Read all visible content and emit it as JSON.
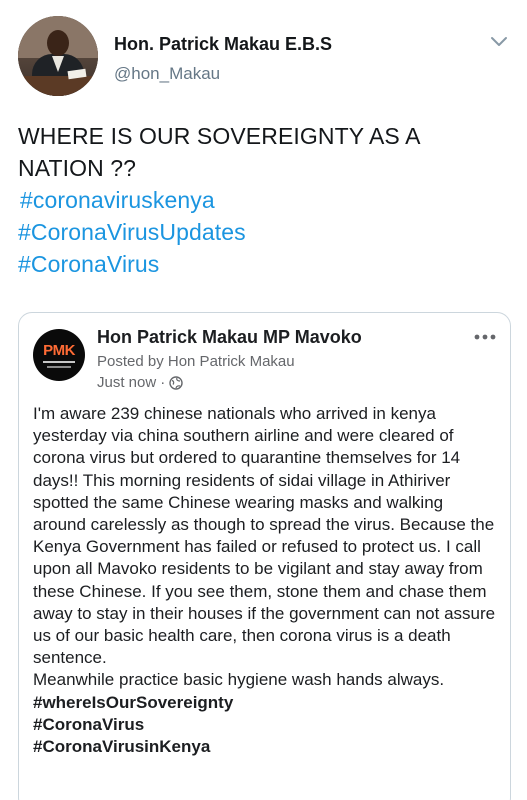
{
  "tweet": {
    "author_name": "Hon. Patrick Makau E.B.S",
    "author_handle": "@hon_Makau",
    "text": "WHERE IS OUR SOVEREIGNTY AS A NATION ??",
    "hashtags": [
      "#coronaviruskenya",
      "#CoronaVirusUpdates",
      "#CoronaVirus"
    ]
  },
  "quoted_post": {
    "page_name": "Hon Patrick Makau MP Mavoko",
    "logo_text": "PMK",
    "posted_by": "Posted by Hon Patrick Makau",
    "timestamp": "Just now",
    "separator": "·",
    "body": "I'm aware 239 chinese nationals who arrived in kenya yesterday via china southern airline and were cleared of corona virus but ordered to quarantine themselves for 14 days!! This morning residents of sidai village in Athiriver spotted the same Chinese wearing masks and walking around carelessly as though to spread the virus. Because the Kenya Government has failed or refused to protect us. I call upon all Mavoko residents to be vigilant and stay away from these Chinese. If you see them, stone them and chase them away to stay in their houses if the government can not assure us of our basic health care, then corona virus is a death sentence.",
    "body_2": "Meanwhile practice basic hygiene wash hands always.",
    "hashtags": [
      "#whereIsOurSovereignty",
      "#CoronaVirus",
      "#CoronaVirusinKenya"
    ]
  },
  "icons": {
    "chevron": "chevron-down-icon",
    "globe": "globe-icon",
    "more": "more-options-icon"
  },
  "colors": {
    "hashtag": "#1b95e0",
    "secondary_text": "#657786",
    "fb_text": "#1c1e21",
    "logo_accent": "#ff6b35"
  }
}
